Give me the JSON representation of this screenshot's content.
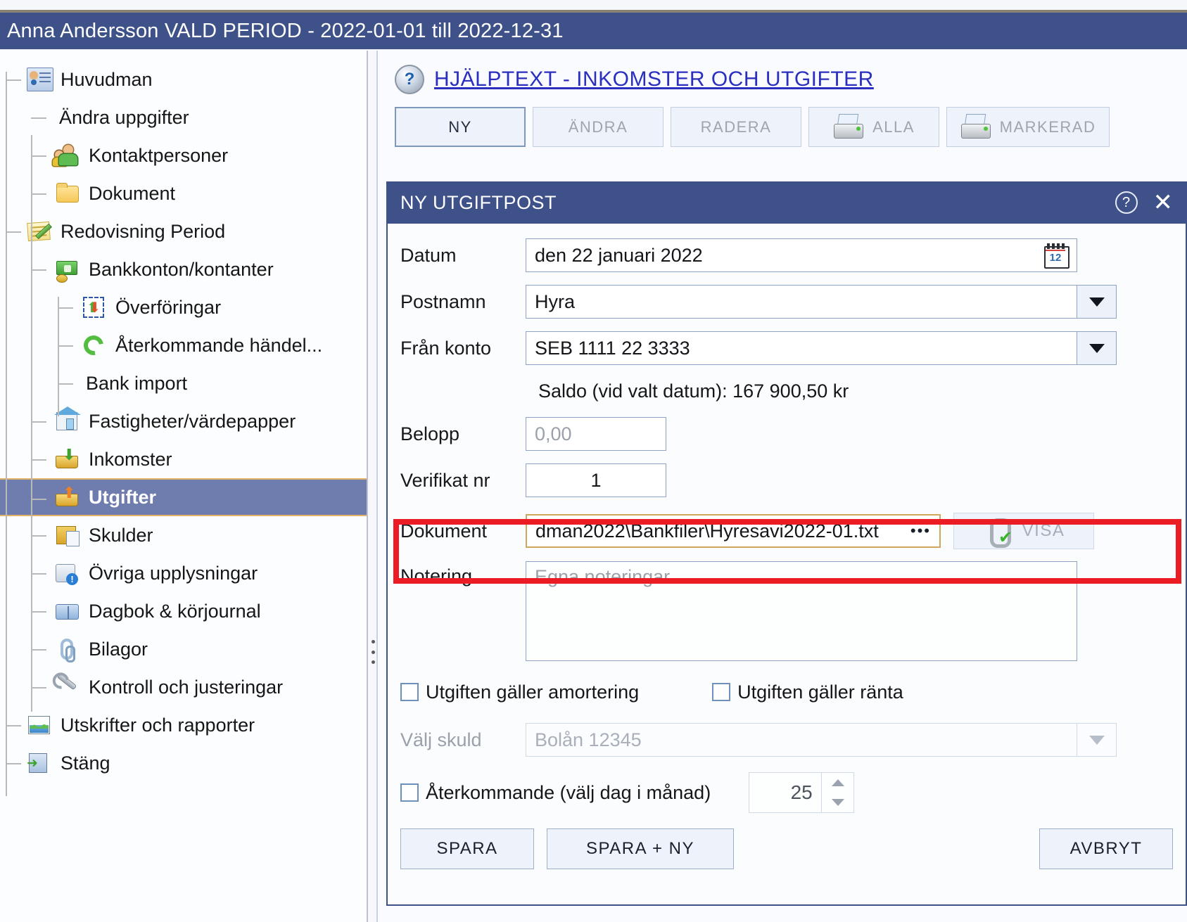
{
  "app": {
    "titlebar": "Anna Andersson  VALD PERIOD - 2022-01-01 till 2022-12-31"
  },
  "sidebar": {
    "items": [
      {
        "label": "Huvudman",
        "icon": "contact-card-icon",
        "level": 0,
        "selected": false
      },
      {
        "label": "Ändra uppgifter",
        "icon": "none",
        "level": 1,
        "selected": false
      },
      {
        "label": "Kontaktpersoner",
        "icon": "people-icon",
        "level": 1,
        "selected": false
      },
      {
        "label": "Dokument",
        "icon": "folder-icon",
        "level": 1,
        "selected": false
      },
      {
        "label": "Redovisning Period",
        "icon": "note-pencil-icon",
        "level": 0,
        "selected": false
      },
      {
        "label": "Bankkonton/kontanter",
        "icon": "money-icon",
        "level": 1,
        "selected": false
      },
      {
        "label": "Överföringar",
        "icon": "transfer-icon",
        "level": 2,
        "selected": false
      },
      {
        "label": "Återkommande  händel...",
        "icon": "recycle-icon",
        "level": 2,
        "selected": false
      },
      {
        "label": "Bank import",
        "icon": "none",
        "level": 2,
        "selected": false
      },
      {
        "label": "Fastigheter/värdepapper",
        "icon": "house-icon",
        "level": 1,
        "selected": false
      },
      {
        "label": "Inkomster",
        "icon": "tray-in-icon",
        "level": 1,
        "selected": false
      },
      {
        "label": "Utgifter",
        "icon": "tray-out-icon",
        "level": 1,
        "selected": true
      },
      {
        "label": "Skulder",
        "icon": "debt-doc-icon",
        "level": 1,
        "selected": false
      },
      {
        "label": "Övriga upplysningar",
        "icon": "info-note-icon",
        "level": 1,
        "selected": false
      },
      {
        "label": "Dagbok & körjournal",
        "icon": "book-icon",
        "level": 1,
        "selected": false
      },
      {
        "label": "Bilagor",
        "icon": "paperclip-icon",
        "level": 1,
        "selected": false
      },
      {
        "label": "Kontroll och justeringar",
        "icon": "wrench-icon",
        "level": 1,
        "selected": false
      },
      {
        "label": "Utskrifter och rapporter",
        "icon": "chart-icon",
        "level": 0,
        "selected": false
      },
      {
        "label": "Stäng",
        "icon": "exit-icon",
        "level": 0,
        "selected": false
      }
    ]
  },
  "main": {
    "help_link": "HJÄLPTEXT  -  INKOMSTER  OCH  UTGIFTER",
    "toolbar": [
      {
        "label": "NY",
        "enabled": true,
        "icon": "none"
      },
      {
        "label": "ÄNDRA",
        "enabled": false,
        "icon": "none"
      },
      {
        "label": "RADERA",
        "enabled": false,
        "icon": "none"
      },
      {
        "label": "ALLA",
        "enabled": false,
        "icon": "printer-icon"
      },
      {
        "label": "MARKERAD",
        "enabled": false,
        "icon": "printer-icon"
      }
    ]
  },
  "dialog": {
    "title": "NY UTGIFTPOST",
    "fields": {
      "datum_label": "Datum",
      "datum_value": "den 22 januari 2022",
      "postnamn_label": "Postnamn",
      "postnamn_value": "Hyra",
      "fran_konto_label": "Från konto",
      "fran_konto_value": "SEB 1111 22 3333",
      "saldo_text": "Saldo (vid valt datum): 167 900,50 kr",
      "belopp_label": "Belopp",
      "belopp_value": "0,00",
      "verifikat_label": "Verifikat nr",
      "verifikat_value": "1",
      "dokument_label": "Dokument",
      "dokument_value": "dman2022\\Bankfiler\\Hyresavi2022-01.txt",
      "dokument_dots": "•••",
      "visa_label": "VISA",
      "notering_label": "Notering",
      "notering_placeholder": "Egna noteringar"
    },
    "checkboxes": {
      "amortering_label": "Utgiften gäller amortering",
      "amortering_checked": false,
      "ranta_label": "Utgiften gäller ränta",
      "ranta_checked": false,
      "aterkommande_label": "Återkommande (välj dag i månad)",
      "aterkommande_checked": false
    },
    "skuld": {
      "label": "Välj skuld",
      "value": "Bolån 12345",
      "enabled": false
    },
    "day_spinner": {
      "value": "25"
    },
    "buttons": {
      "spara": "SPARA",
      "spara_ny": "SPARA + NY",
      "avbryt": "AVBRYT"
    },
    "titlebar_icons": {
      "help": "?",
      "close": "✕"
    }
  },
  "colors": {
    "titlebar_blue": "#3e5289",
    "selection_blue": "#6f7cae",
    "selection_border": "#e3b269",
    "highlight_red": "#ec1c24",
    "doc_field_border": "#cda85c",
    "link_blue": "#2b2fbf"
  }
}
